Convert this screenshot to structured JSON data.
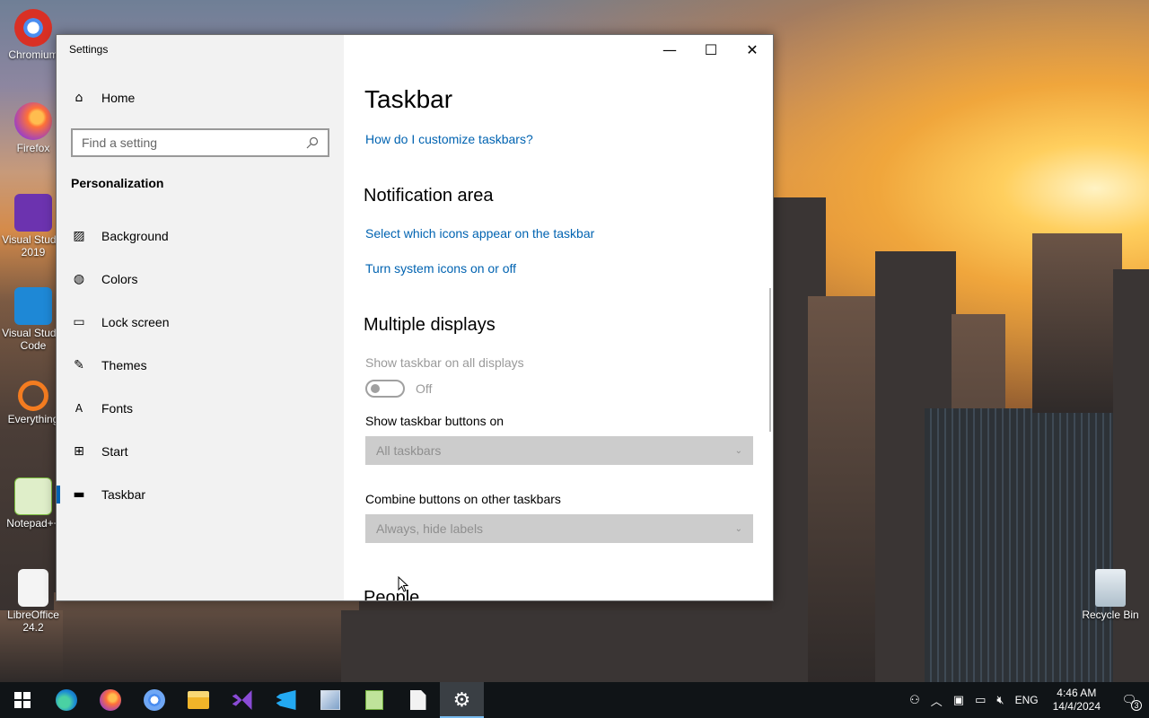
{
  "desktop": {
    "icons": [
      {
        "label": "Chromium",
        "icon": "chromium-icon"
      },
      {
        "label": "Firefox",
        "icon": "firefox-icon"
      },
      {
        "label": "Visual Studio 2019",
        "icon": "visual-studio-icon"
      },
      {
        "label": "Visual Studio Code",
        "icon": "vscode-icon"
      },
      {
        "label": "Everything",
        "icon": "everything-icon"
      },
      {
        "label": "Notepad++",
        "icon": "notepadpp-icon"
      },
      {
        "label": "LibreOffice 24.2",
        "icon": "libreoffice-icon"
      },
      {
        "label": "Recycle Bin",
        "icon": "recycle-bin-icon"
      }
    ]
  },
  "window": {
    "title": "Settings",
    "sidebar": {
      "home_label": "Home",
      "search_placeholder": "Find a setting",
      "section_title": "Personalization",
      "items": [
        {
          "label": "Background",
          "icon": "picture-icon"
        },
        {
          "label": "Colors",
          "icon": "palette-icon"
        },
        {
          "label": "Lock screen",
          "icon": "lock-screen-icon"
        },
        {
          "label": "Themes",
          "icon": "brush-icon"
        },
        {
          "label": "Fonts",
          "icon": "font-icon"
        },
        {
          "label": "Start",
          "icon": "start-icon"
        },
        {
          "label": "Taskbar",
          "icon": "taskbar-icon",
          "active": true
        }
      ]
    },
    "content": {
      "title": "Taskbar",
      "help_link": "How do I customize taskbars?",
      "notification_area": {
        "heading": "Notification area",
        "link1": "Select which icons appear on the taskbar",
        "link2": "Turn system icons on or off"
      },
      "multiple_displays": {
        "heading": "Multiple displays",
        "show_all_label": "Show taskbar on all displays",
        "toggle_state": "Off",
        "buttons_on_label": "Show taskbar buttons on",
        "buttons_on_value": "All taskbars",
        "combine_label": "Combine buttons on other taskbars",
        "combine_value": "Always, hide labels"
      },
      "next_heading": "People"
    }
  },
  "taskbar": {
    "apps": [
      "start-icon",
      "edge-icon",
      "firefox-icon",
      "chromium-icon",
      "file-explorer-icon",
      "visual-studio-icon",
      "vscode-icon",
      "paint-icon",
      "notepadpp-icon",
      "file-icon",
      "settings-icon"
    ],
    "active_app": "settings-icon",
    "tray": {
      "language": "ENG",
      "time": "4:46 AM",
      "date": "14/4/2024",
      "notification_count": "3"
    }
  },
  "colors": {
    "accent": "#0063b1",
    "taskbar": "#101417",
    "sidebar": "#f2f2f2"
  }
}
